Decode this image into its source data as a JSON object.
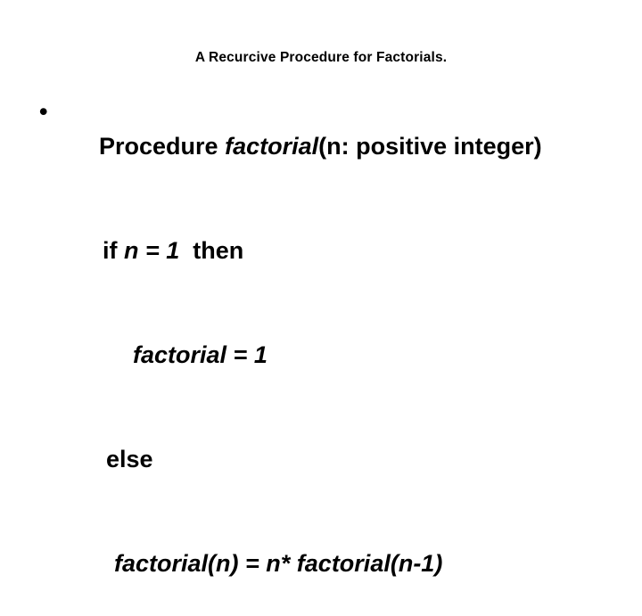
{
  "slide": {
    "background_color": "#ffffff",
    "text_color": "#000000",
    "title": "A Recurcive Procedure for Factorials.",
    "bullet_marker": "•",
    "lines": [
      {
        "name": "procedure-signature",
        "segments": [
          {
            "text": "Procedure ",
            "style": "upright"
          },
          {
            "text": "factorial",
            "style": "italic"
          },
          {
            "text": "(n: positive integer)",
            "style": "upright"
          }
        ],
        "plain": "Procedure factorial(n: positive integer)"
      },
      {
        "name": "if-condition",
        "segments": [
          {
            "text": "if ",
            "style": "upright"
          },
          {
            "text": "n = 1",
            "style": "italic"
          },
          {
            "text": "  then",
            "style": "upright"
          }
        ],
        "plain": "if n = 1  then"
      },
      {
        "name": "base-case-assignment",
        "segments": [
          {
            "text": "factorial = 1",
            "style": "italic"
          }
        ],
        "plain": "factorial = 1"
      },
      {
        "name": "else-keyword",
        "segments": [
          {
            "text": "else",
            "style": "upright"
          }
        ],
        "plain": "else"
      },
      {
        "name": "recursive-case",
        "segments": [
          {
            "text": "factorial(n) = n* factorial(n-1)",
            "style": "italic"
          }
        ],
        "plain": "factorial(n) = n* factorial(n-1)"
      }
    ],
    "line_parts": {
      "procedure_prefix": "Procedure ",
      "procedure_name": "factorial",
      "procedure_params": "(n: positive integer)",
      "if_keyword": "if ",
      "if_expression": "n = 1",
      "then_keyword": "  then",
      "base_case": "factorial = 1",
      "else_keyword": "else",
      "recursive_case": "factorial(n) = n* factorial(n-1)"
    }
  }
}
